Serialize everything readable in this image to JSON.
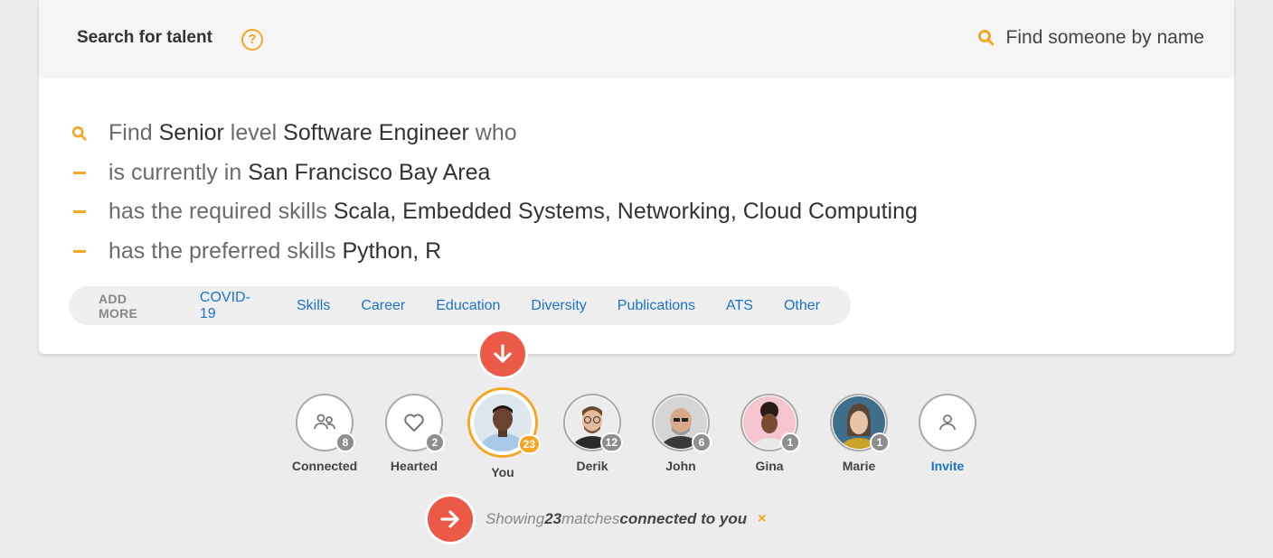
{
  "header": {
    "title": "Search for talent",
    "help_symbol": "?",
    "name_search_placeholder": "Find someone by name"
  },
  "criteria": [
    [
      {
        "t": "Find ",
        "s": false
      },
      {
        "t": "Senior",
        "s": true
      },
      {
        "t": " level ",
        "s": false
      },
      {
        "t": "Software Engineer",
        "s": true
      },
      {
        "t": " who",
        "s": false
      }
    ],
    [
      {
        "t": "is currently in ",
        "s": false
      },
      {
        "t": "San Francisco Bay Area",
        "s": true
      }
    ],
    [
      {
        "t": "has the required skills ",
        "s": false
      },
      {
        "t": "Scala, Embedded Systems, Networking, Cloud Computing",
        "s": true
      }
    ],
    [
      {
        "t": "has the preferred skills ",
        "s": false
      },
      {
        "t": "Python, R",
        "s": true
      }
    ]
  ],
  "add_more": {
    "label": "ADD MORE",
    "links": [
      "COVID-19",
      "Skills",
      "Career",
      "Education",
      "Diversity",
      "Publications",
      "ATS",
      "Other"
    ]
  },
  "network": [
    {
      "label": "Connected",
      "count": "8",
      "icon": "people-icon"
    },
    {
      "label": "Hearted",
      "count": "2",
      "icon": "heart-icon"
    },
    {
      "label": "You",
      "count": "23",
      "icon": "avatar-you",
      "selected": true
    },
    {
      "label": "Derik",
      "count": "12",
      "icon": "avatar-derik"
    },
    {
      "label": "John",
      "count": "6",
      "icon": "avatar-john"
    },
    {
      "label": "Gina",
      "count": "1",
      "icon": "avatar-gina"
    },
    {
      "label": "Marie",
      "count": "1",
      "icon": "avatar-marie"
    },
    {
      "label": "Invite",
      "count": "",
      "icon": "person-icon",
      "link": true
    }
  ],
  "status": {
    "prefix": "Showing ",
    "count": "23",
    "middle": " matches ",
    "suffix": "connected to you",
    "close": "×"
  },
  "colors": {
    "accent": "#f5a623",
    "link": "#1a73c9",
    "red_button": "#ec5a47"
  }
}
